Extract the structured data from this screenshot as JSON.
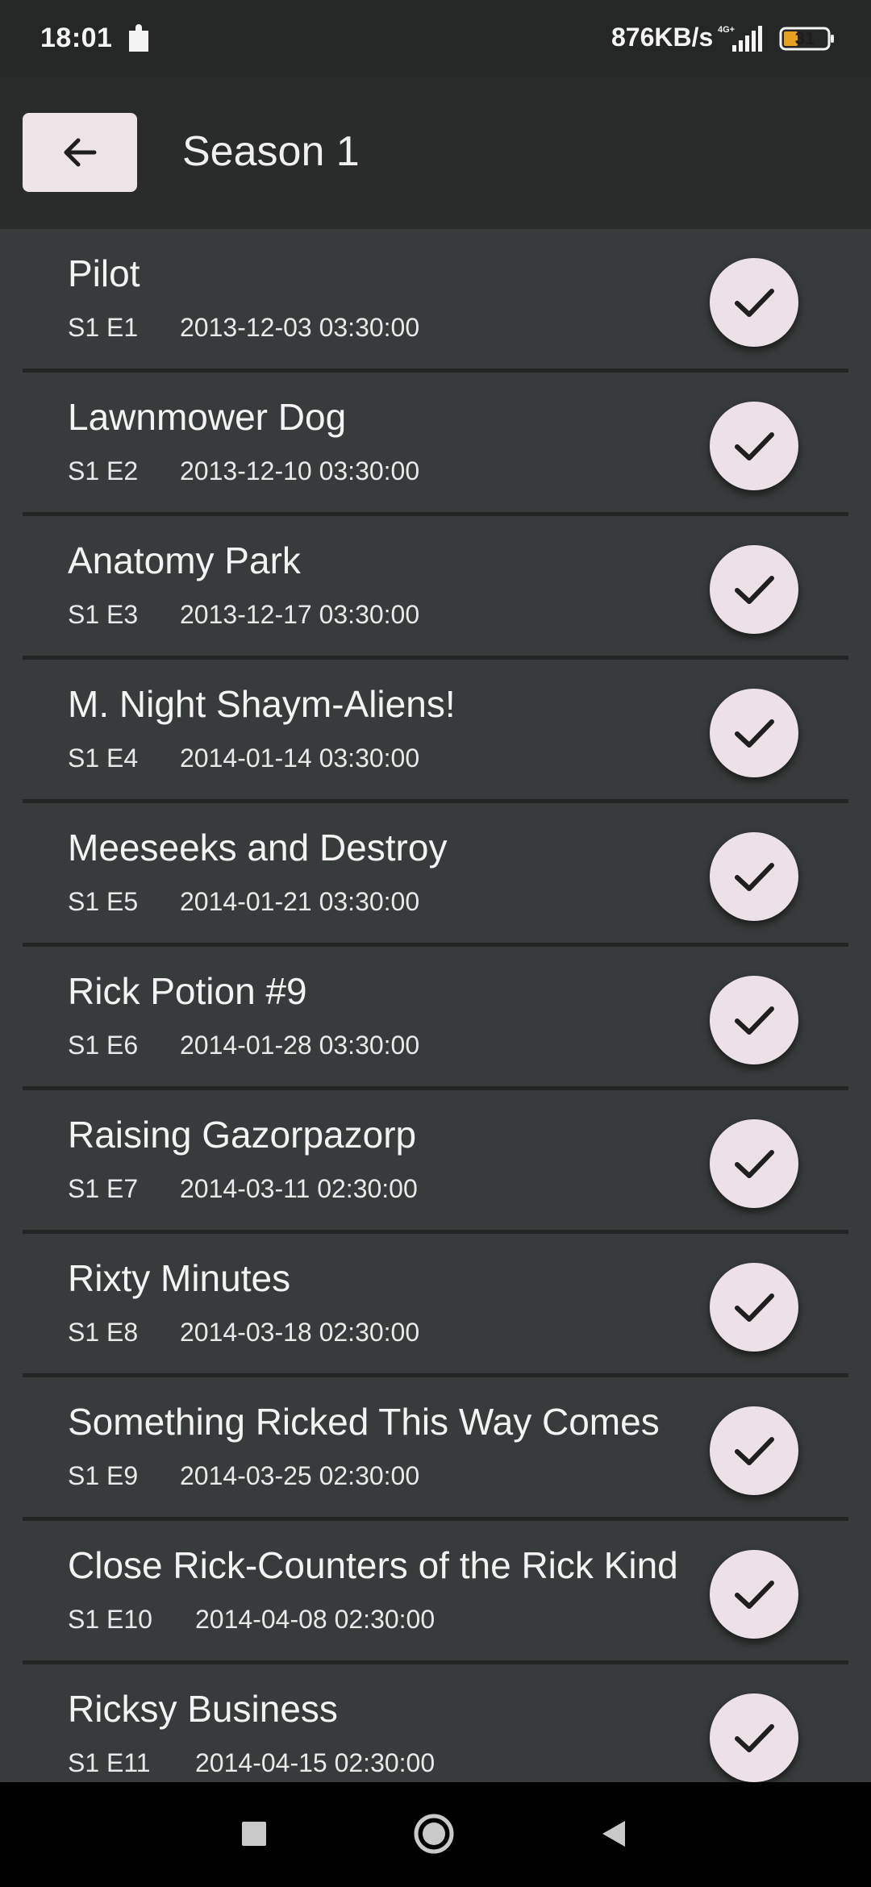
{
  "status_bar": {
    "time": "18:01",
    "network_speed": "876KB/s",
    "network_type": "4G+",
    "battery_level": "31"
  },
  "header": {
    "title": "Season 1",
    "back_icon": "arrow-left-icon"
  },
  "colors": {
    "background": "#383b3b",
    "app_bar": "#2a2c2c",
    "button_fill": "#ebe1e6",
    "check": "#1f1f1f",
    "battery_accent": "#e8a020"
  },
  "episodes": [
    {
      "title": "Pilot",
      "code": "S1 E1",
      "air_date": "2013-12-03 03:30:00",
      "watched_icon": "check-icon"
    },
    {
      "title": "Lawnmower Dog",
      "code": "S1 E2",
      "air_date": "2013-12-10 03:30:00",
      "watched_icon": "check-icon"
    },
    {
      "title": "Anatomy Park",
      "code": "S1 E3",
      "air_date": "2013-12-17 03:30:00",
      "watched_icon": "check-icon"
    },
    {
      "title": "M. Night Shaym-Aliens!",
      "code": "S1 E4",
      "air_date": "2014-01-14 03:30:00",
      "watched_icon": "check-icon"
    },
    {
      "title": "Meeseeks and Destroy",
      "code": "S1 E5",
      "air_date": "2014-01-21 03:30:00",
      "watched_icon": "check-icon"
    },
    {
      "title": "Rick Potion #9",
      "code": "S1 E6",
      "air_date": "2014-01-28 03:30:00",
      "watched_icon": "check-icon"
    },
    {
      "title": "Raising Gazorpazorp",
      "code": "S1 E7",
      "air_date": "2014-03-11 02:30:00",
      "watched_icon": "check-icon"
    },
    {
      "title": "Rixty Minutes",
      "code": "S1 E8",
      "air_date": "2014-03-18 02:30:00",
      "watched_icon": "check-icon"
    },
    {
      "title": "Something Ricked This Way Comes",
      "code": "S1 E9",
      "air_date": "2014-03-25 02:30:00",
      "watched_icon": "check-icon"
    },
    {
      "title": "Close Rick-Counters of the Rick Kind",
      "code": "S1 E10",
      "air_date": "2014-04-08 02:30:00",
      "watched_icon": "check-icon"
    },
    {
      "title": "Ricksy Business",
      "code": "S1 E11",
      "air_date": "2014-04-15 02:30:00",
      "watched_icon": "check-icon"
    }
  ],
  "nav_bar": {
    "recents_icon": "square-icon",
    "home_icon": "circle-icon",
    "back_icon": "triangle-back-icon"
  }
}
